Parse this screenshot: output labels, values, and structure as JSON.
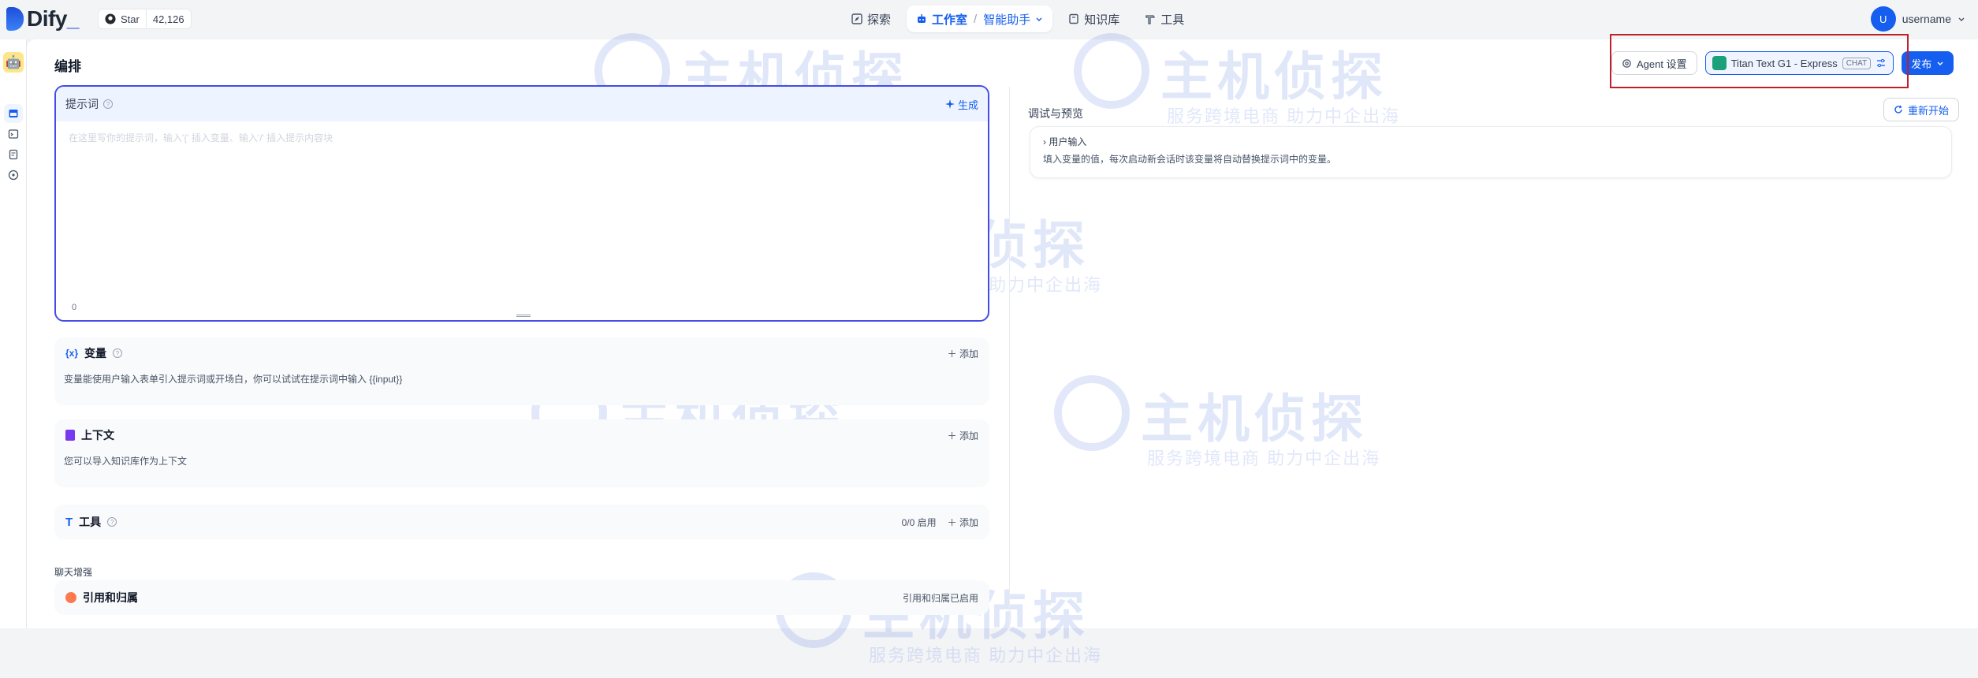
{
  "app": {
    "logo_text": "Dify",
    "github_star_label": "Star",
    "github_star_count": "42,126"
  },
  "nav": {
    "explore": "探索",
    "studio": "工作室",
    "studio_sub": "智能助手",
    "knowledge": "知识库",
    "tools": "工具"
  },
  "user": {
    "avatar_initial": "U",
    "name": "username"
  },
  "page": {
    "title": "编排",
    "agent_settings": "Agent 设置",
    "model_name": "Titan Text G1 - Express",
    "model_tag": "CHAT",
    "publish": "发布"
  },
  "prompt": {
    "label": "提示词",
    "generate": "生成",
    "placeholder": "在这里写你的提示词，输入'{' 插入变量、输入'/' 插入提示内容块",
    "char_count": "0"
  },
  "variables": {
    "title": "变量",
    "add": "添加",
    "description": "变量能使用户输入表单引入提示词或开场白，你可以试试在提示词中输入 {{input}}"
  },
  "context": {
    "title": "上下文",
    "add": "添加",
    "description": "您可以导入知识库作为上下文"
  },
  "tools_section": {
    "title": "工具",
    "enabled_count": "0/0 启用",
    "add": "添加"
  },
  "chat_enhance": {
    "label": "聊天增强",
    "citation_title": "引用和归属",
    "citation_status": "引用和归属已启用"
  },
  "debug": {
    "title": "调试与预览",
    "restart": "重新开始",
    "user_input_title": "用户输入",
    "user_input_desc": "填入变量的值，每次启动新会话时该变量将自动替换提示词中的变量。"
  },
  "watermark": {
    "main": "主机侦探",
    "sub": "服务跨境电商 助力中企出海"
  },
  "colors": {
    "primary": "#155eef",
    "prompt_border": "#444ce7",
    "highlight_box": "#c0202b"
  }
}
